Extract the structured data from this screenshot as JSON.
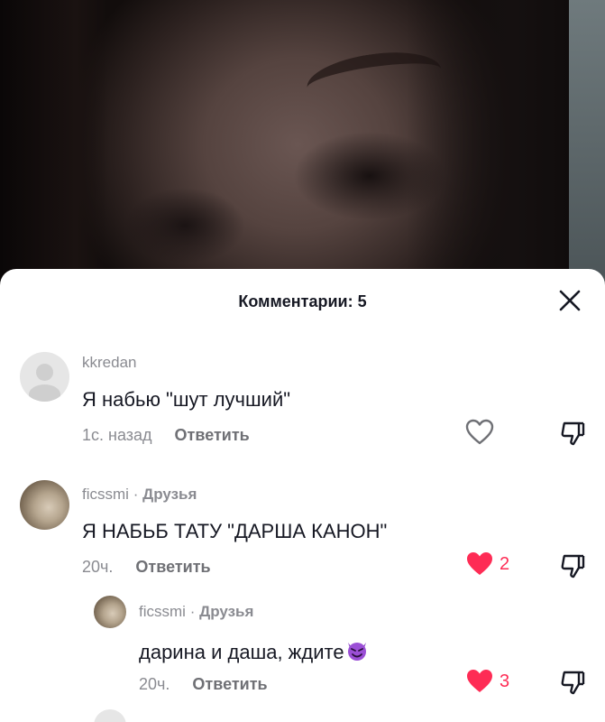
{
  "sheet": {
    "title": "Комментарии: 5"
  },
  "comments": [
    {
      "username": "kkredan",
      "text": "Я набью \"шут лучший\"",
      "time": "1с. назад",
      "reply_label": "Ответить",
      "likes": "",
      "liked": false
    },
    {
      "username": "ficssmi",
      "separator": "·",
      "badge": "Друзья",
      "text": "Я НАБЬБ ТАТУ \"ДАРША КАНОН\"",
      "time": "20ч.",
      "reply_label": "Ответить",
      "likes": "2",
      "liked": true
    },
    {
      "username": "ficssmi",
      "separator": "·",
      "badge": "Друзья",
      "text": "дарина и даша, ждите",
      "emoji": "smiling-devil-emoji",
      "time": "20ч.",
      "reply_label": "Ответить",
      "likes": "3",
      "liked": true
    }
  ],
  "colors": {
    "like_active": "#fe2c55",
    "text": "#161823",
    "muted": "#8a8b91"
  }
}
